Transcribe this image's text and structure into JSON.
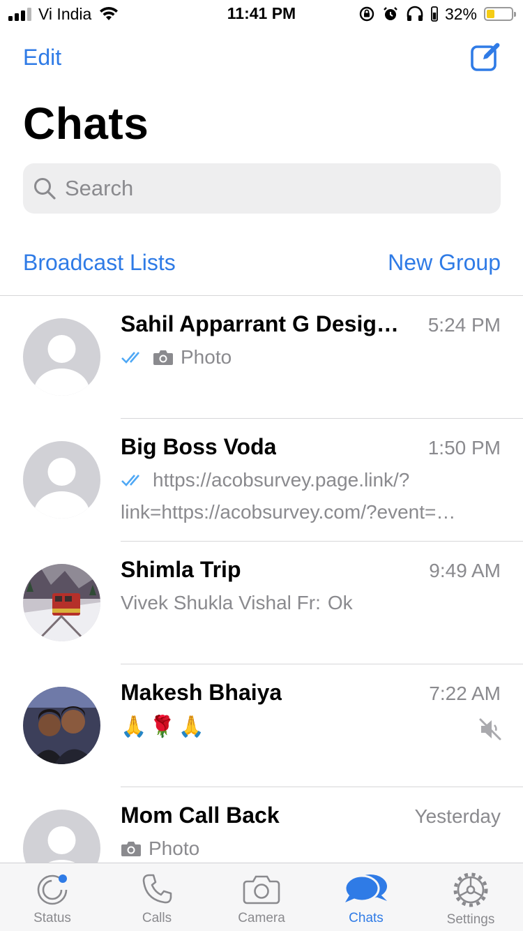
{
  "status_bar": {
    "carrier": "Vi India",
    "time": "11:41 PM",
    "battery_percent": "32%",
    "battery_level": 0.32,
    "battery_color": "#f5cc15"
  },
  "header": {
    "edit_label": "Edit",
    "title": "Chats",
    "compose_icon": "compose-icon"
  },
  "search": {
    "placeholder": "Search"
  },
  "links": {
    "broadcast": "Broadcast Lists",
    "new_group": "New Group"
  },
  "chats": [
    {
      "name": "Sahil Apparrant G Design Studio",
      "time": "5:24 PM",
      "preview": "Photo",
      "read_ticks": true,
      "has_photo_icon": true
    },
    {
      "name": "Big Boss Voda",
      "time": "1:50 PM",
      "preview": "https://acobsurvey.page.link/?",
      "preview_line2": "link=https://acobsurvey.com/?event=survey",
      "read_ticks": true
    },
    {
      "name": "Shimla Trip",
      "time": "9:49 AM",
      "preview_sender": "Vivek Shukla Vishal Fr:",
      "preview": "Ok"
    },
    {
      "name": "Makesh Bhaiya",
      "time": "7:22 AM",
      "preview": "🙏🌹🙏",
      "muted": true
    },
    {
      "name": "Mom Call Back",
      "time": "Yesterday",
      "preview": "Photo",
      "has_photo_icon": true
    }
  ],
  "tabs": [
    {
      "label": "Status",
      "icon": "status-icon"
    },
    {
      "label": "Calls",
      "icon": "phone-icon"
    },
    {
      "label": "Camera",
      "icon": "camera-icon"
    },
    {
      "label": "Chats",
      "icon": "chat-bubbles-icon",
      "active": true
    },
    {
      "label": "Settings",
      "icon": "gear-icon"
    }
  ],
  "colors": {
    "accent": "#2f7be6",
    "tick_blue": "#4fa8f5",
    "secondary_text": "#8a8a8e"
  }
}
